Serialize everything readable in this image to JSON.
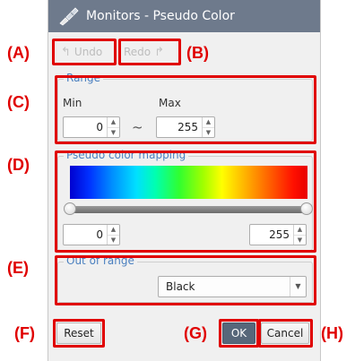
{
  "window": {
    "title": "Monitors - Pseudo Color",
    "icon": "brush-icon"
  },
  "toolbar": {
    "undo_label": "Undo",
    "undo_icon": "undo-arrow-icon",
    "redo_label": "Redo",
    "redo_icon": "redo-arrow-icon"
  },
  "range": {
    "title": "Range",
    "min_label": "Min",
    "max_label": "Max",
    "min_value": "0",
    "max_value": "255",
    "separator": "~"
  },
  "mapping": {
    "title": "Pseudo color mapping",
    "low_value": "0",
    "high_value": "255"
  },
  "out_of_range": {
    "title": "Out of range",
    "selected": "Black"
  },
  "buttons": {
    "reset": "Reset",
    "ok": "OK",
    "cancel": "Cancel"
  },
  "callouts": {
    "a": "(A)",
    "b": "(B)",
    "c": "(C)",
    "d": "(D)",
    "e": "(E)",
    "f": "(F)",
    "g": "(G)",
    "h": "(H)"
  },
  "colors": {
    "annotation": "#e00000",
    "title_bar": "#6e7a8c",
    "group_title": "#4a7fbf",
    "ok_button": "#57677a"
  }
}
